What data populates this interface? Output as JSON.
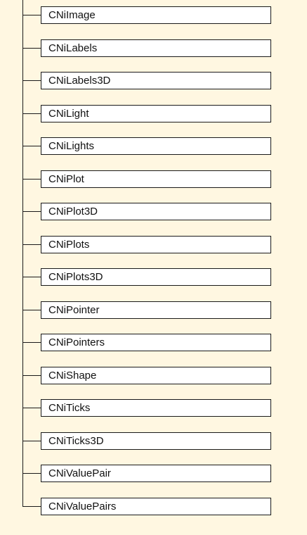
{
  "tree": {
    "nodes": [
      {
        "label": "CNiImage"
      },
      {
        "label": "CNiLabels"
      },
      {
        "label": "CNiLabels3D"
      },
      {
        "label": "CNiLight"
      },
      {
        "label": "CNiLights"
      },
      {
        "label": "CNiPlot"
      },
      {
        "label": "CNiPlot3D"
      },
      {
        "label": "CNiPlots"
      },
      {
        "label": "CNiPlots3D"
      },
      {
        "label": "CNiPointer"
      },
      {
        "label": "CNiPointers"
      },
      {
        "label": "CNiShape"
      },
      {
        "label": "CNiTicks"
      },
      {
        "label": "CNiTicks3D"
      },
      {
        "label": "CNiValuePair"
      },
      {
        "label": "CNiValuePairs"
      }
    ]
  },
  "colors": {
    "background": "#fff7e1",
    "box_fill": "#ffffff",
    "line": "#1a1a1a",
    "text": "#111111"
  }
}
